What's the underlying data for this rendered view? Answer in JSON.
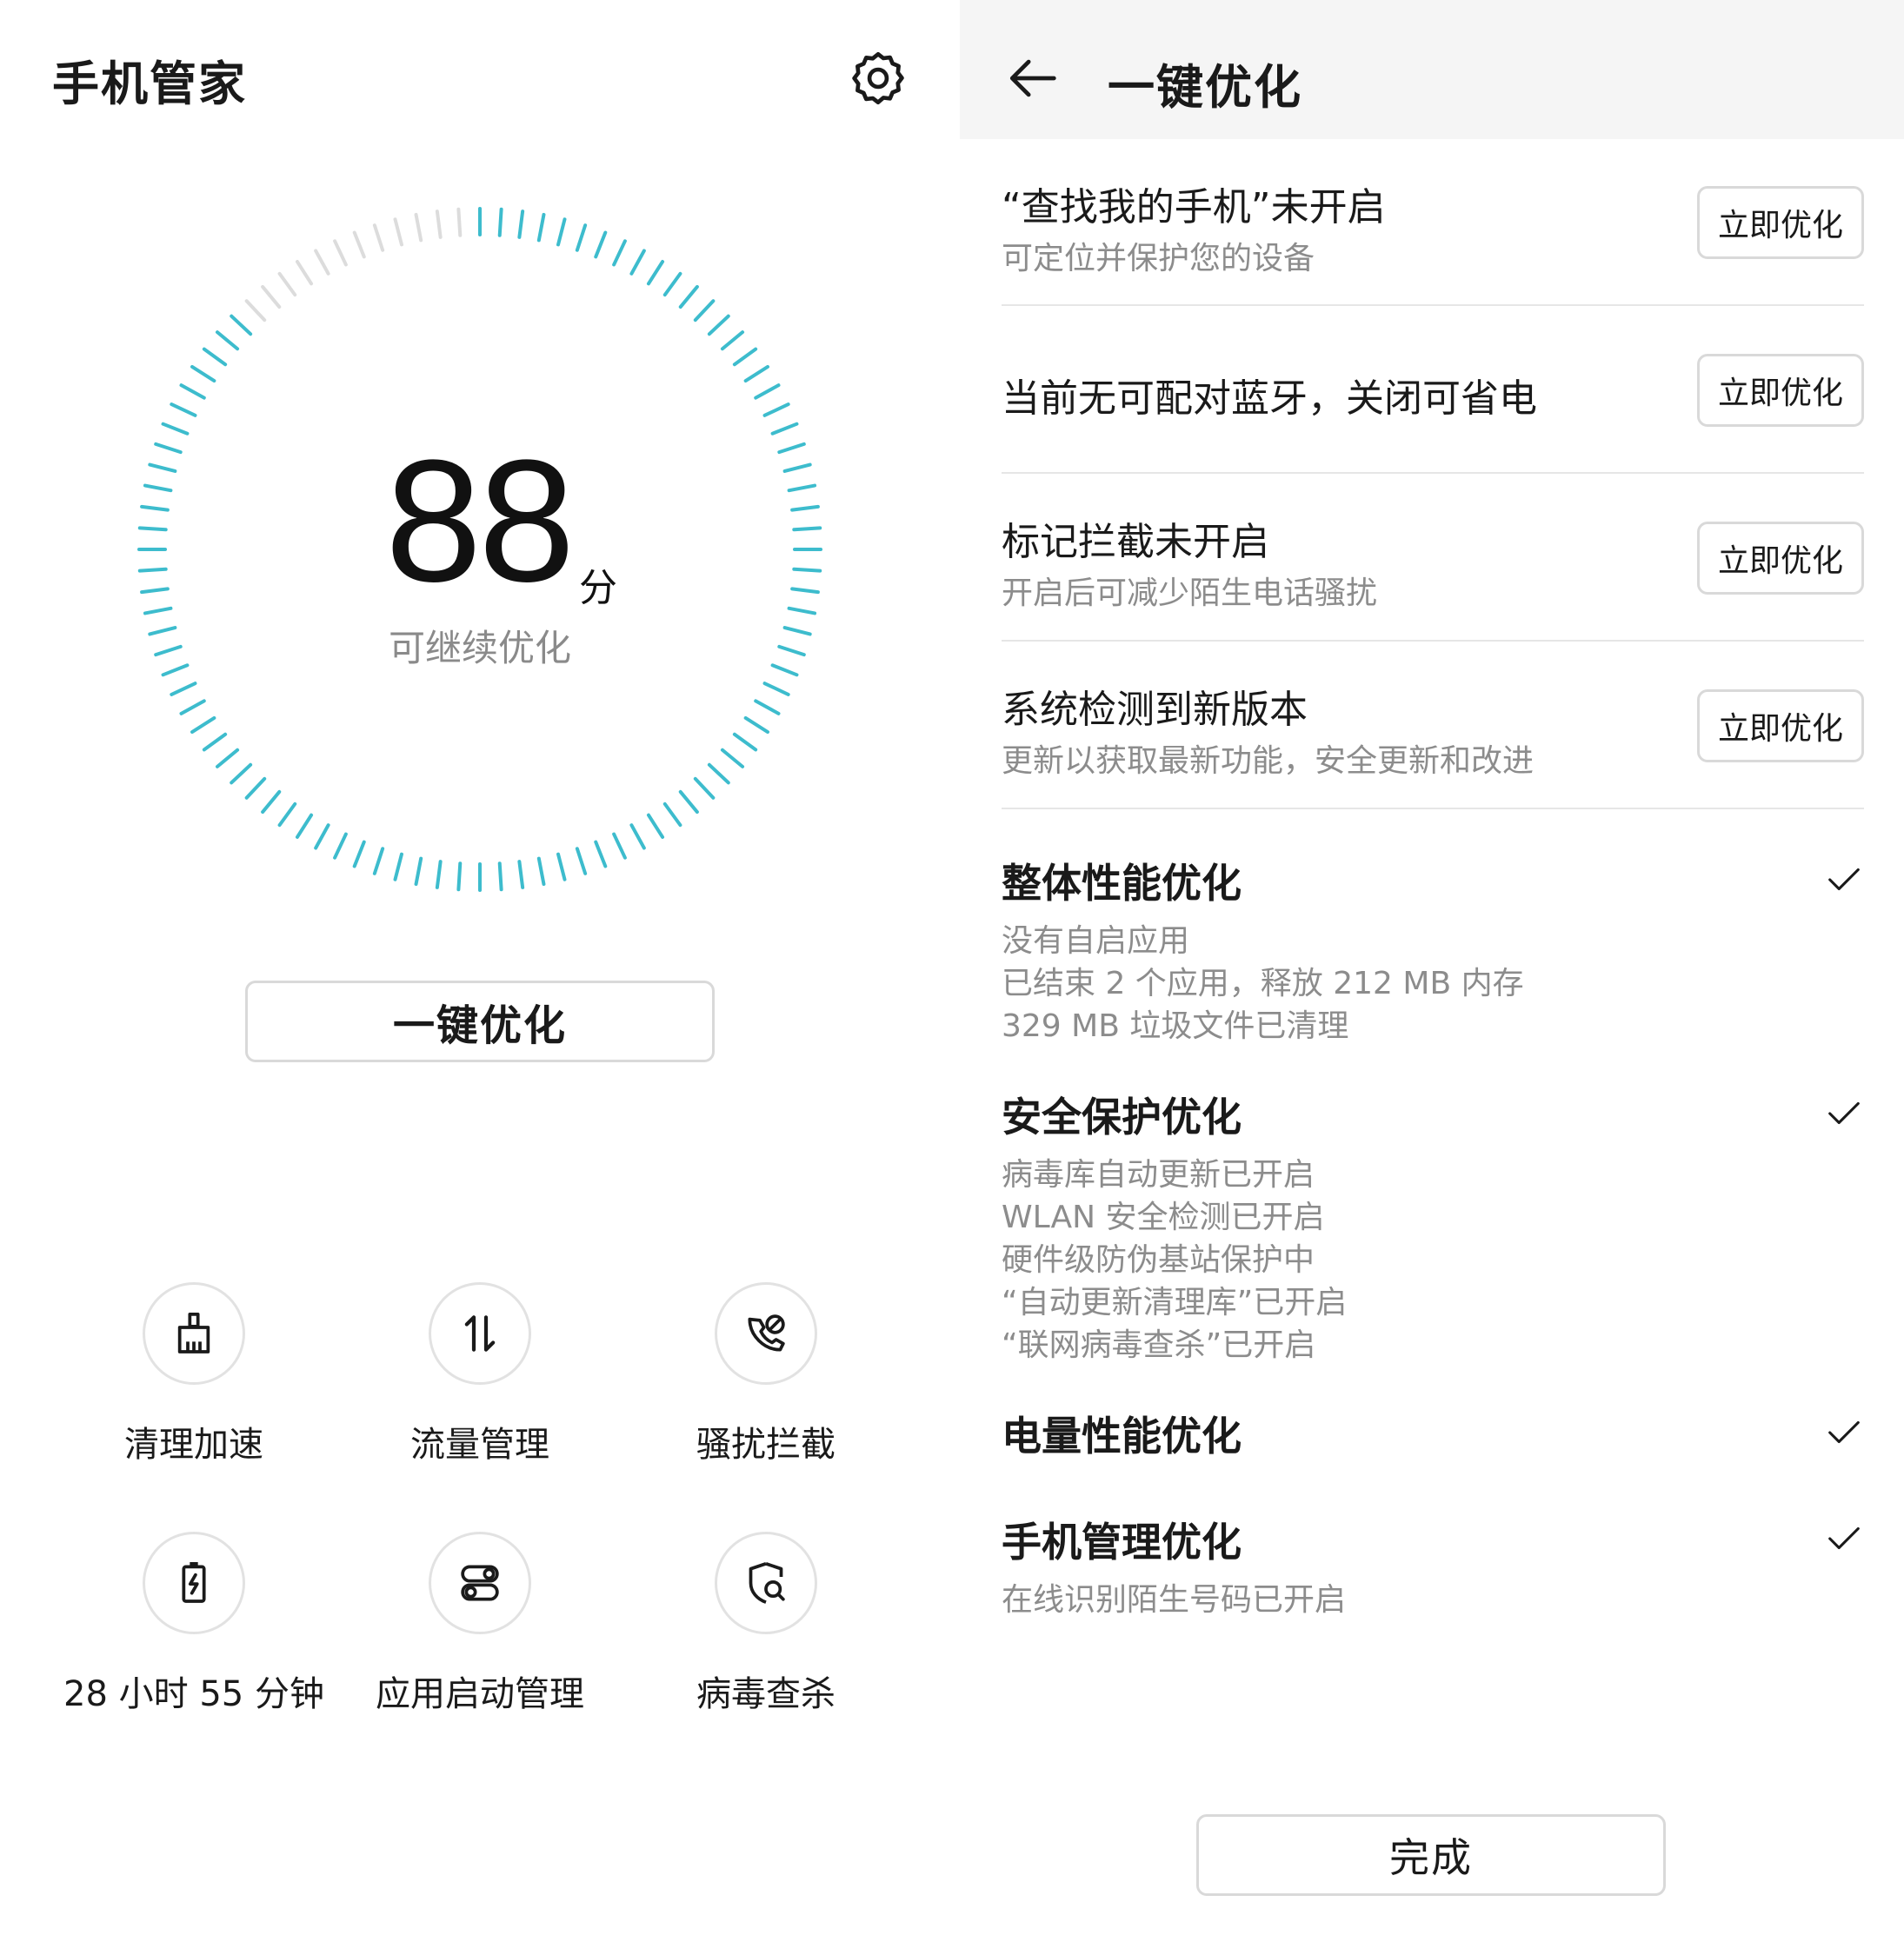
{
  "home": {
    "title": "手机管家",
    "settings_icon": "gear-icon",
    "score": "88",
    "score_unit": "分",
    "score_status": "可继续优化",
    "optimize_button": "一键优化",
    "dial_color": "#3dbccd",
    "dial_inactive_color": "#dcdcdc",
    "tools": [
      {
        "label": "清理加速",
        "icon": "broom-icon"
      },
      {
        "label": "流量管理",
        "icon": "data-arrows-icon"
      },
      {
        "label": "骚扰拦截",
        "icon": "phone-block-icon"
      },
      {
        "label": "28 小时 55 分钟",
        "icon": "battery-icon"
      },
      {
        "label": "应用启动管理",
        "icon": "toggle-icon"
      },
      {
        "label": "病毒查杀",
        "icon": "shield-search-icon"
      }
    ]
  },
  "optimize": {
    "title": "一键优化",
    "back_icon": "arrow-left-icon",
    "issues": [
      {
        "title": "“查找我的手机”未开启",
        "subtitle": "可定位并保护您的设备",
        "button": "立即优化"
      },
      {
        "title": "当前无可配对蓝牙，关闭可省电",
        "subtitle": "",
        "button": "立即优化"
      },
      {
        "title": "标记拦截未开启",
        "subtitle": "开启后可减少陌生电话骚扰",
        "button": "立即优化"
      },
      {
        "title": "系统检测到新版本",
        "subtitle": "更新以获取最新功能，安全更新和改进",
        "button": "立即优化"
      }
    ],
    "completed": [
      {
        "title": "整体性能优化",
        "lines": [
          "没有自启应用",
          "已结束 2 个应用，释放 212 MB 内存",
          "329 MB 垃圾文件已清理"
        ]
      },
      {
        "title": "安全保护优化",
        "lines": [
          "病毒库自动更新已开启",
          "WLAN 安全检测已开启",
          "硬件级防伪基站保护中",
          "“自动更新清理库”已开启",
          "“联网病毒查杀”已开启"
        ]
      },
      {
        "title": "电量性能优化",
        "lines": []
      },
      {
        "title": "手机管理优化",
        "lines": [
          "在线识别陌生号码已开启"
        ]
      }
    ],
    "finish_button": "完成"
  }
}
